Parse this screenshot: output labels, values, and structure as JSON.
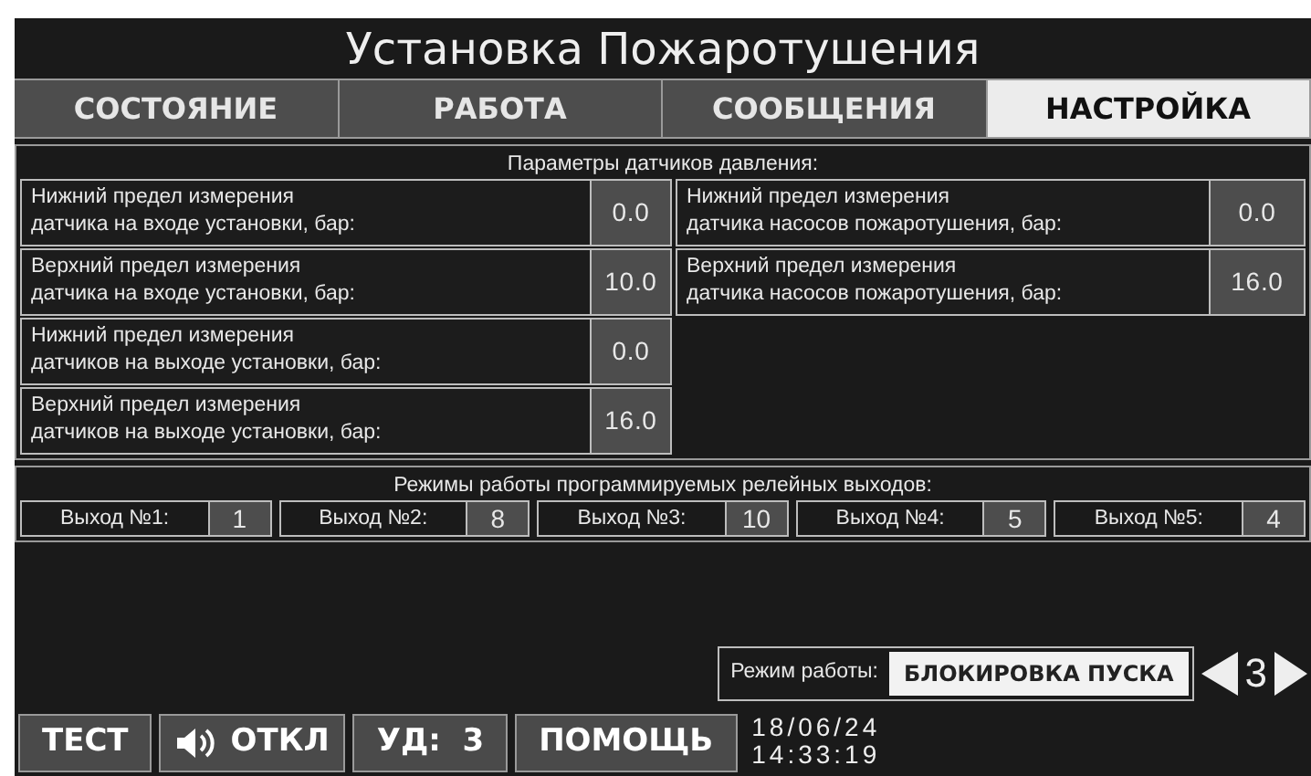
{
  "title": "Установка Пожаротушения",
  "tabs": [
    {
      "label": "СОСТОЯНИЕ",
      "selected": false
    },
    {
      "label": "РАБОТА",
      "selected": false
    },
    {
      "label": "СООБЩЕНИЯ",
      "selected": false
    },
    {
      "label": "НАСТРОЙКА",
      "selected": true
    }
  ],
  "sensors": {
    "title": "Параметры датчиков давления:",
    "left": [
      {
        "lines": [
          "Нижний предел измерения",
          "датчика на входе установки, бар:"
        ],
        "value": "0.0"
      },
      {
        "lines": [
          "Верхний предел измерения",
          "датчика на входе установки, бар:"
        ],
        "value": "10.0"
      },
      {
        "lines": [
          "Нижний предел измерения",
          "датчиков на выходе установки, бар:"
        ],
        "value": "0.0"
      },
      {
        "lines": [
          "Верхний предел измерения",
          "датчиков на выходе установки, бар:"
        ],
        "value": "16.0"
      }
    ],
    "right": [
      {
        "lines": [
          "Нижний предел измерения",
          "датчика насосов пожаротушения, бар:"
        ],
        "value": "0.0"
      },
      {
        "lines": [
          "Верхний предел измерения",
          "датчика насосов пожаротушения, бар:"
        ],
        "value": "16.0"
      }
    ]
  },
  "relays": {
    "title": "Режимы работы программируемых релейных выходов:",
    "outputs": [
      {
        "label": "Выход №1:",
        "value": "1"
      },
      {
        "label": "Выход №2:",
        "value": "8"
      },
      {
        "label": "Выход №3:",
        "value": "10"
      },
      {
        "label": "Выход №4:",
        "value": "5"
      },
      {
        "label": "Выход №5:",
        "value": "4"
      }
    ]
  },
  "mode": {
    "label": "Режим работы:",
    "value": "БЛОКИРОВКА ПУСКА",
    "number": "3"
  },
  "buttons": [
    {
      "kind": "text",
      "label": "ТЕСТ"
    },
    {
      "kind": "sound",
      "label": "ОТКЛ"
    },
    {
      "kind": "text",
      "label": "УД:  3"
    },
    {
      "kind": "text",
      "label": "ПОМОЩЬ"
    }
  ],
  "date": "18/06/24",
  "time": "14:33:19"
}
